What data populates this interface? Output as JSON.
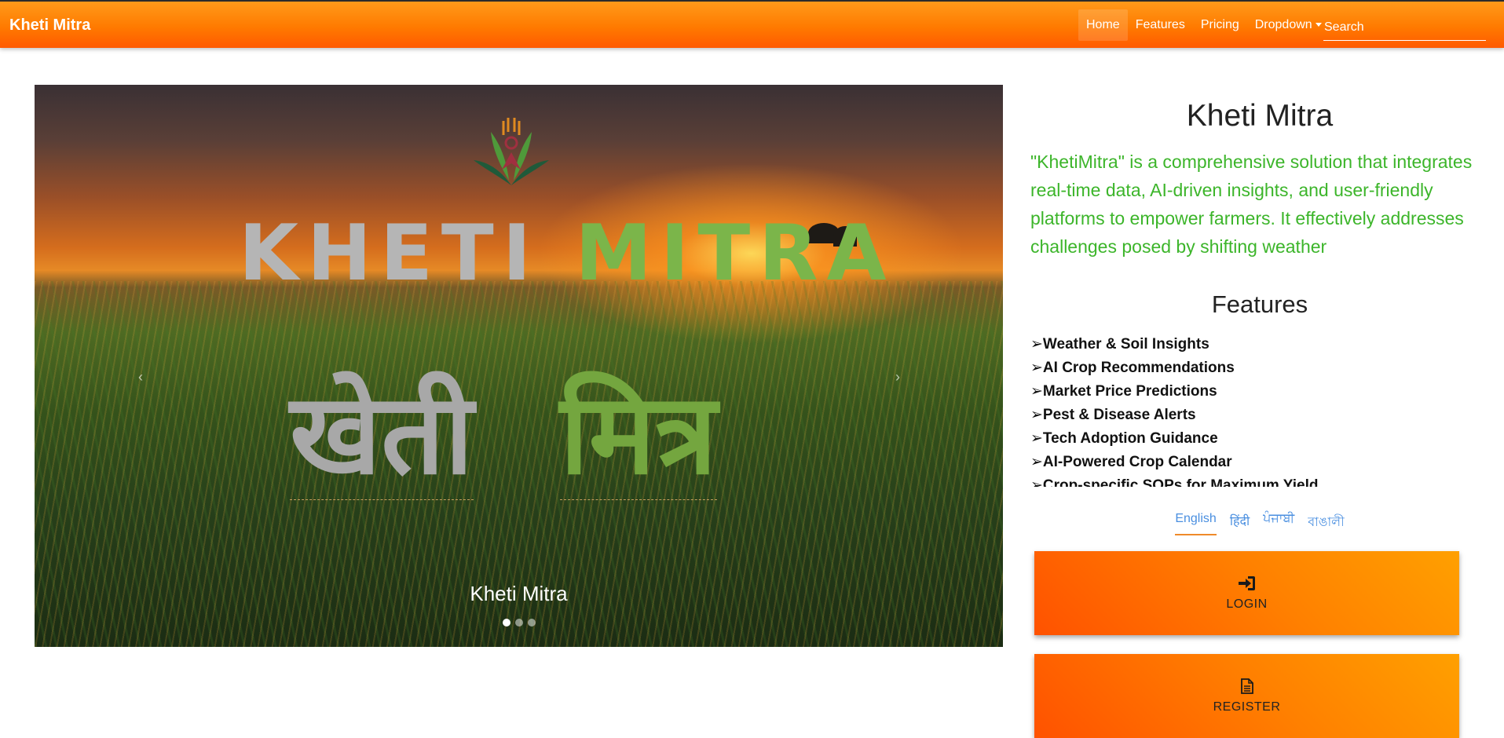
{
  "navbar": {
    "brand": "Kheti Mitra",
    "links": [
      {
        "label": "Home",
        "active": true
      },
      {
        "label": "Features"
      },
      {
        "label": "Pricing"
      },
      {
        "label": "Dropdown"
      }
    ],
    "search_placeholder": "Search"
  },
  "carousel": {
    "title_en_part1": "KHETI",
    "title_en_part2": "MITRA",
    "title_hi_part1": "खेती",
    "title_hi_part2": "मित्र",
    "caption": "Kheti Mitra",
    "prev_icon": "‹",
    "next_icon": "›",
    "slide_count": 3,
    "active_slide": 1
  },
  "side": {
    "title": "Kheti Mitra",
    "description": "\"KhetiMitra\" is a comprehensive solution that integrates real-time data, AI-driven insights, and user-friendly platforms to empower farmers. It effectively addresses challenges posed by shifting weather",
    "features_title": "Features",
    "features": [
      "➢Weather & Soil Insights",
      "➢AI Crop Recommendations",
      "➢Market Price Predictions",
      "➢Pest & Disease Alerts",
      "➢Tech Adoption Guidance",
      "➢AI-Powered Crop Calendar",
      "➢Crop-specific SOPs for Maximum Yield"
    ],
    "languages": [
      {
        "label": "English",
        "active": true
      },
      {
        "label": "हिंदी"
      },
      {
        "label": "ਪੰਜਾਬੀ"
      },
      {
        "label": "বাঙালী"
      }
    ],
    "login_label": "LOGIN",
    "register_label": "REGISTER"
  },
  "colors": {
    "nav_orange": "#ff7a00",
    "description_green": "#3cb52a",
    "link_blue": "#4a8fe0",
    "active_underline": "#ef8a2a"
  }
}
